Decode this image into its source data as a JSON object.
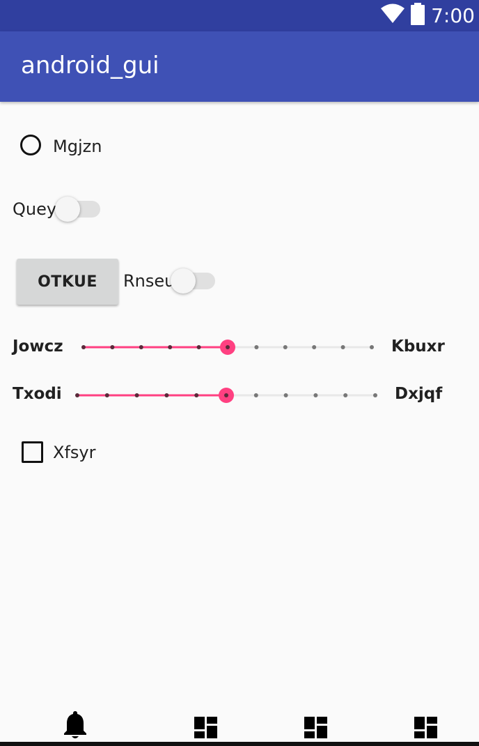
{
  "status_bar": {
    "time": "7:00",
    "wifi_icon": "wifi-icon",
    "battery_icon": "battery-icon"
  },
  "app_bar": {
    "title": "android_gui"
  },
  "radio": {
    "label": "Mgjzn",
    "checked": false
  },
  "switch1": {
    "label": "Queyi",
    "on": false
  },
  "button": {
    "label": "OTKUE"
  },
  "switch2": {
    "label": "Rnseu",
    "on": false
  },
  "slider1": {
    "left_label": "Jowcz",
    "right_label": "Kbuxr",
    "steps": 10,
    "value": 5
  },
  "slider2": {
    "left_label": "Txodi",
    "right_label": "Dxjqf",
    "steps": 10,
    "value": 5
  },
  "checkbox": {
    "label": "Xfsyr",
    "checked": false
  },
  "bottom_nav": {
    "items": [
      {
        "icon": "bell-icon"
      },
      {
        "icon": "dashboard-icon"
      },
      {
        "icon": "dashboard-icon"
      },
      {
        "icon": "dashboard-icon"
      }
    ]
  },
  "colors": {
    "accent": "#ff4081",
    "primary": "#3f51b5",
    "primary_dark": "#303f9f"
  }
}
